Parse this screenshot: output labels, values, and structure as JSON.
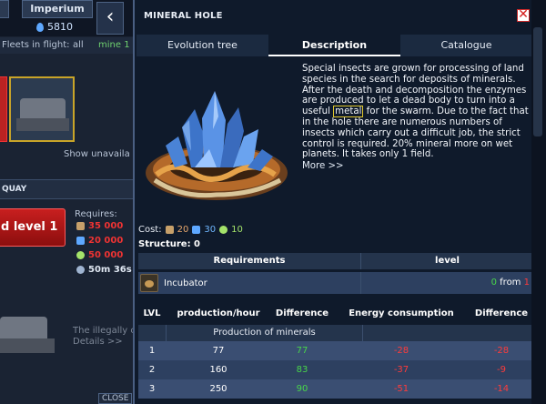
{
  "background": {
    "tab_left": "",
    "tab_imperium": "Imperium",
    "back_glyph": "‹",
    "resource_value": "5810",
    "fleets_label": "Fleets in flight:",
    "fleets_all": "all",
    "fleets_mine": "mine 1",
    "show_unavailable": "Show unavaila",
    "section_label": "QUAY",
    "upgrade_button": "d level 1",
    "requires_label": "Requires:",
    "req_metal": "35 000",
    "req_crystal": "20 000",
    "req_gas": "50 000",
    "req_time": "50m 36s",
    "illegal_text": "The illegally cr",
    "details_link": "Details >>",
    "close_label": "CLOSE"
  },
  "modal": {
    "title": "MINERAL HOLE",
    "close_glyph": "✕",
    "tabs": [
      {
        "label": "Evolution tree"
      },
      {
        "label": "Description"
      },
      {
        "label": "Catalogue"
      }
    ],
    "description_before": "Special insects are grown for processing of land species in the search for deposits of minerals. After the death and decomposition the enzymes are produced to let a dead body to turn into a useful ",
    "description_highlight": "metal",
    "description_after": " for the swarm. Due to the fact that in the hole there are numerous numbers of insects which carry out a difficult job, the strict control is required. 20% mineral more on wet planets. It takes only 1 field.",
    "more_link": "More >>",
    "cost_label": "Cost:",
    "cost_metal": "20",
    "cost_crystal": "30",
    "cost_gas": "10",
    "structure": "Structure: 0",
    "requirements": {
      "header_requirements": "Requirements",
      "header_level": "level",
      "rows": [
        {
          "name": "Incubator",
          "have": "0",
          "from_label": "from",
          "need": "1"
        }
      ]
    },
    "production": {
      "headers": [
        "LVL",
        "production/hour",
        "Difference",
        "Energy consumption",
        "Difference"
      ],
      "subheader": "Production of minerals",
      "rows": [
        {
          "lvl": "1",
          "prod": "77",
          "diff": "77",
          "energy": "-28",
          "ediff": "-28"
        },
        {
          "lvl": "2",
          "prod": "160",
          "diff": "83",
          "energy": "-37",
          "ediff": "-9"
        },
        {
          "lvl": "3",
          "prod": "250",
          "diff": "90",
          "energy": "-51",
          "ediff": "-14"
        }
      ]
    }
  },
  "colors": {
    "accent_red": "#d41c1c",
    "positive_green": "#48d64a",
    "negative_red": "#ff3b3b",
    "highlight_border": "#e0c72c"
  },
  "icons": [
    "back-arrow-icon",
    "drop-icon",
    "close-icon",
    "metal-icon",
    "crystal-icon",
    "gas-icon",
    "incubator-icon",
    "clock-icon"
  ]
}
